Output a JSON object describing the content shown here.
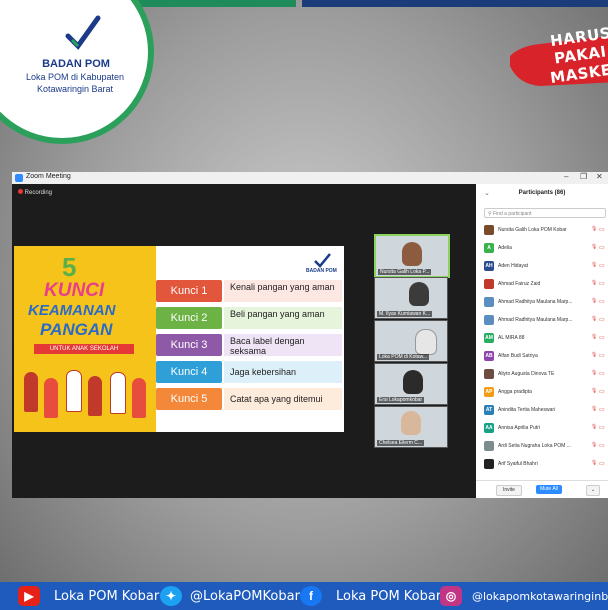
{
  "logo": {
    "title": "BADAN POM",
    "subtitle_line1": "Loka POM di Kabupaten",
    "subtitle_line2": "Kotawaringin Barat"
  },
  "mask_badge": {
    "line1": "HARUS",
    "line2": "PAKAI",
    "line3": "MASKER"
  },
  "zoom": {
    "window_title": "Zoom Meeting",
    "recording_label": "Recording",
    "controls": {
      "minimize": "–",
      "maximize": "❐",
      "close": "✕"
    }
  },
  "slide": {
    "number": "5",
    "headline1": "KUNCI",
    "headline2": "KEAMANAN",
    "headline3": "PANGAN",
    "ribbon": "UNTUK ANAK SEKOLAH",
    "logo_text": "BADAN POM",
    "items": [
      {
        "label": "Kunci 1",
        "text": "Kenali pangan yang aman",
        "color": "#e2563b",
        "bar": "#fde7e2"
      },
      {
        "label": "Kunci 2",
        "text": "Beli pangan yang aman",
        "color": "#6cb244",
        "bar": "#e6f4dc"
      },
      {
        "label": "Kunci 3",
        "text": "Baca label dengan seksama",
        "color": "#8e5aa7",
        "bar": "#efe4f5"
      },
      {
        "label": "Kunci 4",
        "text": "Jaga kebersihan",
        "color": "#2f9fd8",
        "bar": "#ddf0fa"
      },
      {
        "label": "Kunci 5",
        "text": "Catat apa yang ditemui",
        "color": "#f3883a",
        "bar": "#fdebdc"
      }
    ]
  },
  "videos": [
    {
      "name": "Nursita Galih Loka P...",
      "active": true
    },
    {
      "name": "M. Ilyas Kurniawan K...",
      "active": false
    },
    {
      "name": "Loka POM di Kotaw...",
      "active": false
    },
    {
      "name": "Ersi Lokapomkobar",
      "active": false
    },
    {
      "name": "Chelsea Eilerm C...",
      "active": false
    }
  ],
  "participants_panel": {
    "title": "Participants (86)",
    "search_placeholder": "Find a participant",
    "invite_label": "Invite",
    "mute_all_label": "Mute All",
    "more_label": "⌄",
    "rows": [
      {
        "initials": "",
        "name": "Nursita Galih Loka POM Kobar",
        "color": "#7a4b2a"
      },
      {
        "initials": "A",
        "name": "Adelia",
        "color": "#38b24a"
      },
      {
        "initials": "AH",
        "name": "Aden Hidayat",
        "color": "#2a4d8f"
      },
      {
        "initials": "",
        "name": "Ahmad Fairuz Zaid",
        "color": "#c0392b"
      },
      {
        "initials": "",
        "name": "Ahmad Radhitya Maulana Marp...",
        "color": "#5a8fc0"
      },
      {
        "initials": "",
        "name": "Ahmad Radhitya Maulana Marp...",
        "color": "#5a8fc0"
      },
      {
        "initials": "AM",
        "name": "AL MIRA 88",
        "color": "#27ae60"
      },
      {
        "initials": "AB",
        "name": "Alfan Budi Satriya",
        "color": "#8e44ad"
      },
      {
        "initials": "",
        "name": "Aliyto Augusta Dinova TE",
        "color": "#6d4c41"
      },
      {
        "initials": "AP",
        "name": "Angga pradipta",
        "color": "#f39c12"
      },
      {
        "initials": "AT",
        "name": "Anindita Tertia Maheswari",
        "color": "#2980b9"
      },
      {
        "initials": "AA",
        "name": "Annisa Aprilia Putri",
        "color": "#16a085"
      },
      {
        "initials": "",
        "name": "Ardi Setia Nugraha Loka POM ...",
        "color": "#7f8c8d"
      },
      {
        "initials": "",
        "name": "Arif Syaiful Bhahri",
        "color": "#222222"
      }
    ]
  },
  "social": {
    "youtube": "Loka POM Kobar",
    "twitter": "@LokaPOMKobar",
    "facebook": "Loka POM Kobar",
    "instagram": "@lokapomkotawaringinbarat"
  }
}
